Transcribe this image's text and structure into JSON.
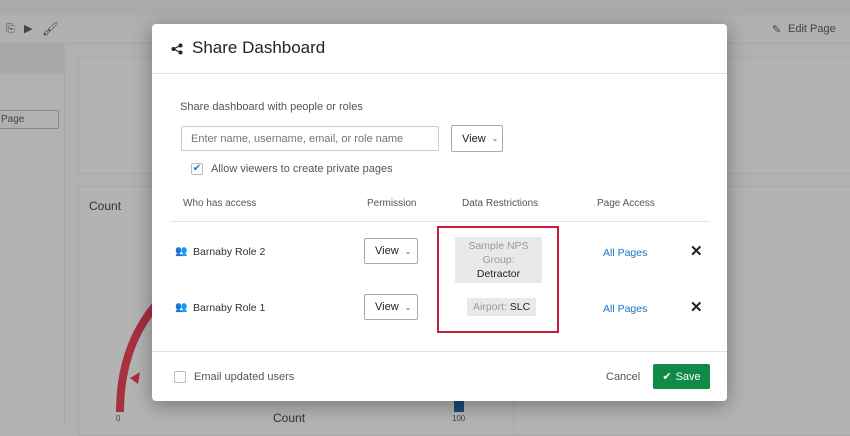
{
  "background": {
    "page_button_label": "Page",
    "edit_page_label": "Edit Page",
    "widget_title": "Count",
    "gauge_min_label": "0",
    "gauge_max_label": "100",
    "gauge_axis_label": "Count",
    "gauge_color": "#a8303f"
  },
  "modal": {
    "title": "Share Dashboard",
    "share_label": "Share dashboard with people or roles",
    "search_placeholder": "Enter name, username, email, or role name",
    "permission_default": "View",
    "allow_private_pages_label": "Allow viewers to create private pages",
    "allow_private_pages_checked": true,
    "columns": [
      "Who has access",
      "Permission",
      "Data Restrictions",
      "Page Access"
    ],
    "rows": [
      {
        "name": "Barnaby Role 2",
        "permission": "View",
        "restriction_key": "Sample NPS Group:",
        "restriction_value": "Detractor",
        "page_access": "All Pages"
      },
      {
        "name": "Barnaby Role 1",
        "permission": "View",
        "restriction_key": "Airport:",
        "restriction_value": "SLC",
        "page_access": "All Pages"
      }
    ],
    "email_updated_users_label": "Email updated users",
    "email_updated_users_checked": false,
    "cancel_label": "Cancel",
    "save_label": "Save",
    "save_color": "#0f8a47",
    "highlight_color": "#c41e3a"
  }
}
